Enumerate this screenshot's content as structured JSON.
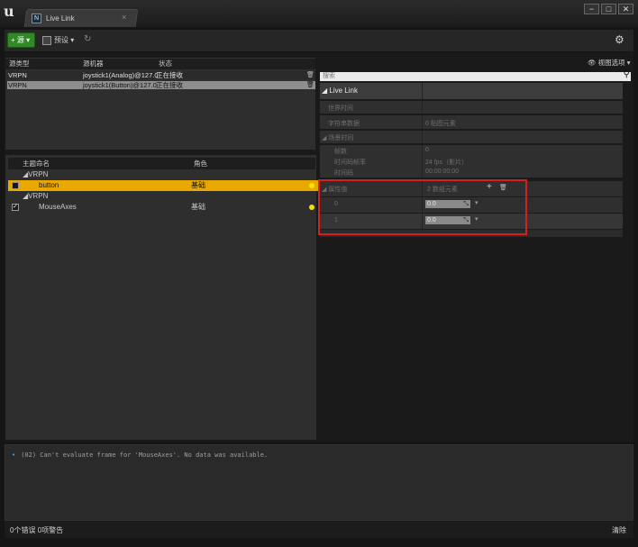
{
  "window": {
    "tab_title": "Live Link",
    "tab_icon_glyph": "N",
    "close_glyph": "×",
    "min_glyph": "−",
    "max_glyph": "□",
    "x_glyph": "✕"
  },
  "toolbar": {
    "source_label": "+ 源 ▾",
    "preset_label": "预设 ▾",
    "undo_glyph": "↻",
    "settings_glyph": "⚙"
  },
  "sources": {
    "columns": [
      "源类型",
      "源机器",
      "状态"
    ],
    "rows": [
      {
        "type": "VRPN",
        "machine": "joystick1(Analog)@127.0",
        "status": "正在接收",
        "selected": false
      },
      {
        "type": "VRPN",
        "machine": "joystick1(Button)@127.0",
        "status": "正在接收",
        "selected": true
      }
    ],
    "trash_glyph": "🗑"
  },
  "subjects": {
    "columns": [
      "主题命名",
      "角色"
    ],
    "groups": [
      {
        "name": "◢VRPN",
        "items": [
          {
            "name": "button",
            "role": "基础",
            "checked": true,
            "selected": true
          }
        ]
      },
      {
        "name": "◢VRPN",
        "items": [
          {
            "name": "MouseAxes",
            "role": "基础",
            "checked": true,
            "selected": false
          }
        ]
      }
    ],
    "check_glyph": "✓"
  },
  "details": {
    "view_options": "👁 视图选项 ▾",
    "search_placeholder": "搜索",
    "search_glyph": "⚲",
    "section_title": "◢ Live Link",
    "world_time": "世界时间",
    "string_data_key": "字符串数据",
    "string_data_val": "0 贴图元素",
    "scene_time": "◢ 场景时间",
    "frames_key": "帧数",
    "frames_val": "0",
    "rate_key": "时间码帧率",
    "rate_val": "24 fps（影片）",
    "timecode_key": "时间码",
    "timecode_val": "00:00:00:00",
    "properties_key": "◢ 属性值",
    "properties_val": "2 数组元素",
    "add_glyph": "+",
    "trash_glyph": "🗑",
    "array": [
      {
        "index": "0",
        "value": "0.0"
      },
      {
        "index": "1",
        "value": "0.0"
      }
    ],
    "drag_glyph": "⤡",
    "dropdown_glyph": "▾"
  },
  "log": {
    "bullet": "•",
    "message": "(02) Can't evaluate frame for 'MouseAxes'. No data was available."
  },
  "status": {
    "errors": "0个错误  0项警告",
    "clear": "清除"
  },
  "colors": {
    "accent_selected": "#e9a800",
    "source_button": "#2f8a26",
    "highlight_box": "#d81f1f"
  }
}
